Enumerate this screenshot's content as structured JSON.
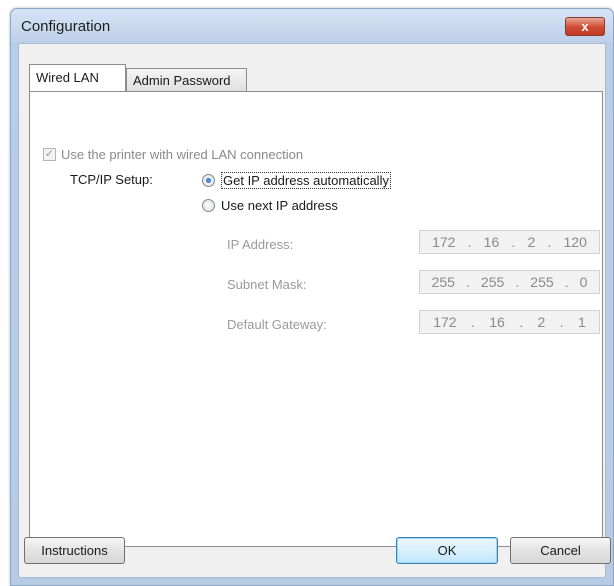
{
  "window": {
    "title": "Configuration",
    "close_label": "x"
  },
  "tabs": [
    {
      "label": "Wired LAN",
      "active": true
    },
    {
      "label": "Admin Password",
      "active": false
    }
  ],
  "wired_lan": {
    "use_wired_checkbox": {
      "label": "Use the printer with wired LAN connection",
      "checked": true,
      "enabled": false
    },
    "tcpip_label": "TCP/IP Setup:",
    "radio_auto": {
      "label": "Get IP address automatically",
      "checked": true
    },
    "radio_manual": {
      "label": "Use next IP address",
      "checked": false
    },
    "ip_address": {
      "label": "IP Address:",
      "octets": [
        "172",
        "16",
        "2",
        "120"
      ]
    },
    "subnet_mask": {
      "label": "Subnet Mask:",
      "octets": [
        "255",
        "255",
        "255",
        "0"
      ]
    },
    "default_gateway": {
      "label": "Default Gateway:",
      "octets": [
        "172",
        "16",
        "2",
        "1"
      ]
    }
  },
  "buttons": {
    "instructions": "Instructions",
    "ok": "OK",
    "cancel": "Cancel"
  },
  "colors": {
    "frame": "#b8cde8",
    "close": "#cf4b33",
    "accent": "#3c7fb1"
  }
}
